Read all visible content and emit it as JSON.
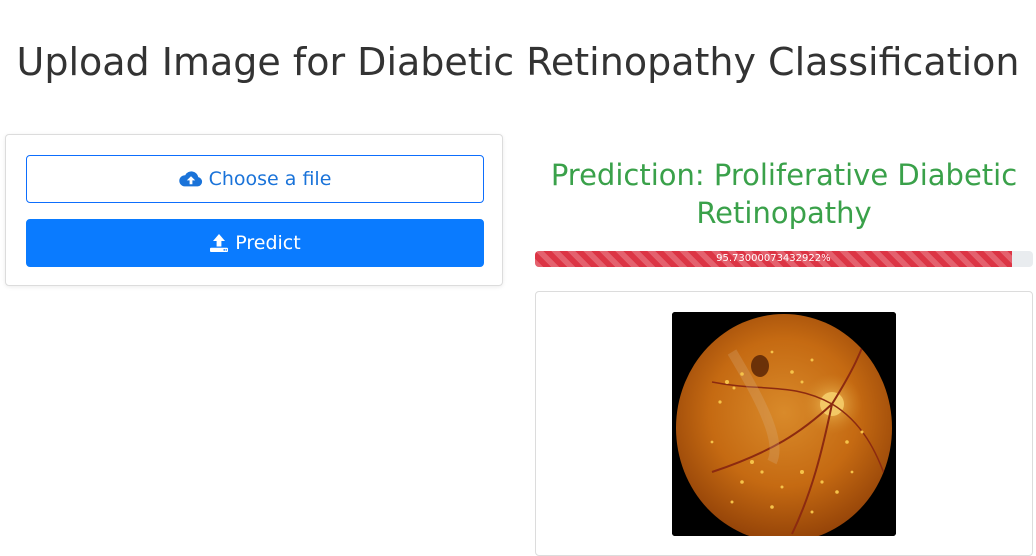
{
  "page": {
    "title": "Upload Image for Diabetic Retinopathy Classification"
  },
  "upload": {
    "choose_label": "Choose a file",
    "choose_icon": "cloud-upload-icon",
    "predict_label": "Predict",
    "predict_icon": "upload-icon"
  },
  "result": {
    "prediction": "Prediction: Proliferative Diabetic Retinopathy",
    "confidence_percent": 95.73000073432922,
    "confidence_label": "95.73000073432922%",
    "image_name": "retinal-fundus-image"
  },
  "colors": {
    "primary": "#0a7bff",
    "prediction_text": "#3aa14a",
    "progress_bar": "#dc3545",
    "progress_track": "#e9ecef"
  }
}
